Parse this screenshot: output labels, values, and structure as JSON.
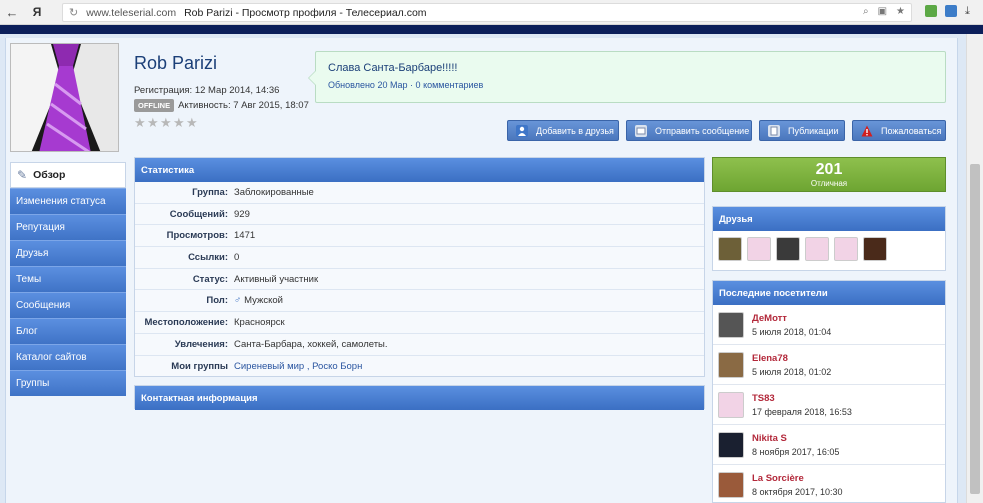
{
  "browser": {
    "back_glyph": "←",
    "yandex_glyph": "Я",
    "reload_glyph": "↻",
    "domain": "www.teleserial.com",
    "title": "Rob Parizi - Просмотр профиля - Телесериал.com",
    "icons": [
      "search-icon",
      "extension-icon",
      "star-icon"
    ],
    "search_glyph": "⌕",
    "ext_glyph": "▣",
    "star_glyph": "★",
    "download_glyph": "⤓"
  },
  "profile": {
    "name": "Rob Parizi",
    "registration": "Регистрация: 12 Мар 2014, 14:36",
    "offline_badge": "OFFLINE",
    "activity": "Активность: 7 Авг 2015, 18:07",
    "rating_stars": 0,
    "rating_max": 5,
    "star_glyph": "★"
  },
  "status": {
    "text": "Слава Санта-Барбаре!!!!!",
    "meta": "Обновлено 20 Мар · 0 комментариев"
  },
  "actions": [
    {
      "label": "Добавить в друзья",
      "icon": "add-friend-icon",
      "color": "#3f76c8"
    },
    {
      "label": "Отправить сообщение",
      "icon": "message-icon",
      "color": "#d9e2ef"
    },
    {
      "label": "Публикации",
      "icon": "publications-icon",
      "color": "#d9e2ef"
    },
    {
      "label": "Пожаловаться",
      "icon": "warning-icon",
      "color": "#d21f1f"
    }
  ],
  "leftnav": {
    "active": "Обзор",
    "active_icon": "✎",
    "items": [
      "Изменения статуса",
      "Репутация",
      "Друзья",
      "Темы",
      "Сообщения",
      "Блог",
      "Каталог сайтов",
      "Группы"
    ]
  },
  "stats": {
    "header": "Статистика",
    "rows": [
      {
        "label": "Группа:",
        "value": "Заблокированные"
      },
      {
        "label": "Сообщений:",
        "value": "929"
      },
      {
        "label": "Просмотров:",
        "value": "1471"
      },
      {
        "label": "Ссылки:",
        "value": "0"
      },
      {
        "label": "Статус:",
        "value": "Активный участник"
      },
      {
        "label": "Пол:",
        "value": "Мужской"
      },
      {
        "label": "Местоположение:",
        "value": "Красноярск"
      },
      {
        "label": "Увлечения:",
        "value": "Санта-Барбара, хоккей, самолеты."
      },
      {
        "label": "Мои группы",
        "value": "Сиреневый мир , Роско Борн"
      }
    ],
    "gender_glyph": "♂"
  },
  "contact": {
    "header": "Контактная информация"
  },
  "rating": {
    "value": "201",
    "label": "Отличная"
  },
  "friends": {
    "header": "Друзья",
    "thumbs": [
      "#6d6038",
      "#f2d3e6",
      "#3a3a3a",
      "#f2d3e6",
      "#f2d3e6",
      "#4a2a1a"
    ]
  },
  "visitors": {
    "header": "Последние посетители",
    "items": [
      {
        "name": "ДеМотт",
        "date": "5 июля 2018, 01:04",
        "thumb": "#555555"
      },
      {
        "name": "Elena78",
        "date": "5 июля 2018, 01:02",
        "thumb": "#8a6a44"
      },
      {
        "name": "TS83",
        "date": "17 февраля 2018, 16:53",
        "thumb": "#f2d3e6"
      },
      {
        "name": "Nikita S",
        "date": "8 ноября 2017, 16:05",
        "thumb": "#1a2030"
      },
      {
        "name": "La Sorcière",
        "date": "8 октября 2017, 10:30",
        "thumb": "#9a5a3a"
      }
    ]
  },
  "colors": {
    "accent": "#3f73c6",
    "rating_green": "#7bb23c",
    "visitor_name": "#b3283a",
    "status_bubble": "#eafbef"
  }
}
